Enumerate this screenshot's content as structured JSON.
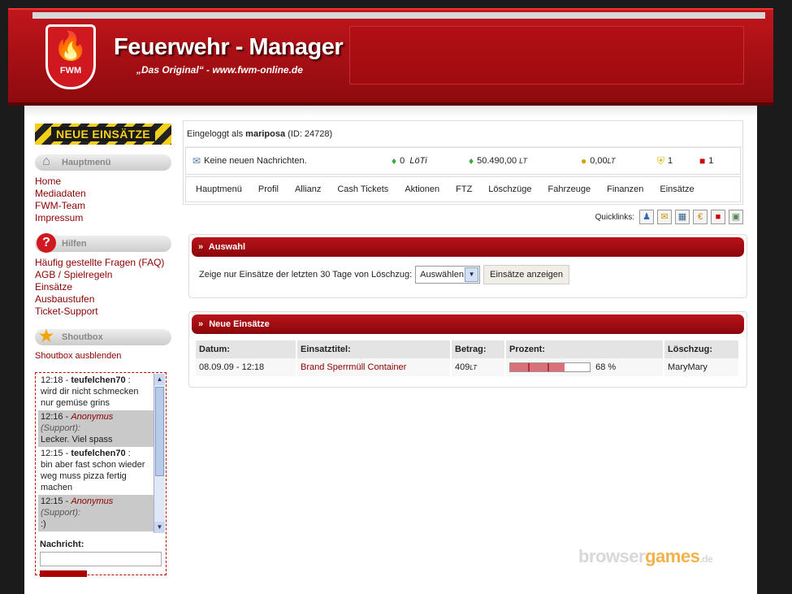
{
  "header": {
    "title": "Feuerwehr - Manager",
    "subtitle": "„Das Original“ - www.fwm-online.de",
    "logo_text": "FWM"
  },
  "sidebar": {
    "new_missions": "NEUE EINSÄTZE",
    "main_menu": {
      "title": "Hauptmenü",
      "items": [
        {
          "label": "Home"
        },
        {
          "label": "Mediadaten"
        },
        {
          "label": "FWM-Team"
        },
        {
          "label": "Impressum"
        }
      ]
    },
    "help": {
      "title": "Hilfen",
      "items": [
        {
          "label": "Häufig gestellte Fragen (FAQ)"
        },
        {
          "label": "AGB / Spielregeln"
        },
        {
          "label": "Einsätze"
        },
        {
          "label": "Ausbaustufen"
        },
        {
          "label": "Ticket-Support"
        }
      ]
    },
    "shoutbox": {
      "title": "Shoutbox",
      "toggle": "Shoutbox ausblenden",
      "messages": [
        {
          "time": "12:18",
          "user": "teufelchen70",
          "role": "",
          "text": "wird dir nicht schmecken nur gemüse grins"
        },
        {
          "time": "12:16",
          "user": "Anonymus",
          "role": "(Support):",
          "text": "Lecker. Viel spass"
        },
        {
          "time": "12:15",
          "user": "teufelchen70",
          "role": "",
          "text": "bin aber fast schon wieder weg muss pizza fertig machen"
        },
        {
          "time": "12:15",
          "user": "Anonymus",
          "role": "(Support):",
          "text": ":)"
        }
      ],
      "message_label": "Nachricht:"
    }
  },
  "user": {
    "login_prefix": "Eingeloggt als",
    "username": "mariposa",
    "id_text": "(ID: 24728)"
  },
  "status": {
    "messages": "Keine neuen Nachrichten.",
    "loeti_value": "0",
    "loeti_unit": "LöTi",
    "money": "50.490,00",
    "money_unit": "LT",
    "coins": "0,00",
    "coins_unit": "LT",
    "shields": "1",
    "trucks": "1"
  },
  "nav": [
    "Hauptmenü",
    "Profil",
    "Allianz",
    "Cash Tickets",
    "Aktionen",
    "FTZ",
    "Löschzüge",
    "Fahrzeuge",
    "Finanzen",
    "Einsätze"
  ],
  "quicklinks_label": "Quicklinks:",
  "quicklinks_icons": [
    "user-icon",
    "mail-icon",
    "calendar-icon",
    "euro-icon",
    "firetruck-icon",
    "building-icon"
  ],
  "selection": {
    "title": "Auswahl",
    "filter_text": "Zeige nur Einsätze der letzten 30 Tage von Löschzug:",
    "select_value": "Auswählen",
    "button": "Einsätze anzeigen"
  },
  "missions": {
    "title": "Neue Einsätze",
    "columns": [
      "Datum:",
      "Einsatztitel:",
      "Betrag:",
      "Prozent:",
      "Löschzug:"
    ],
    "rows": [
      {
        "date": "08.09.09 - 12:18",
        "title": "Brand Sperrmüll Container",
        "amount": "409",
        "amount_unit": "LT",
        "percent": 68,
        "percent_text": "68 %",
        "unit": "MaryMary"
      }
    ]
  },
  "watermark": {
    "part1": "browser",
    "part2": "games",
    "tld": ".de"
  },
  "colors": {
    "brand_red": "#b8141a",
    "link_red": "#8b0000",
    "warning_yellow": "#f2cf1a"
  }
}
